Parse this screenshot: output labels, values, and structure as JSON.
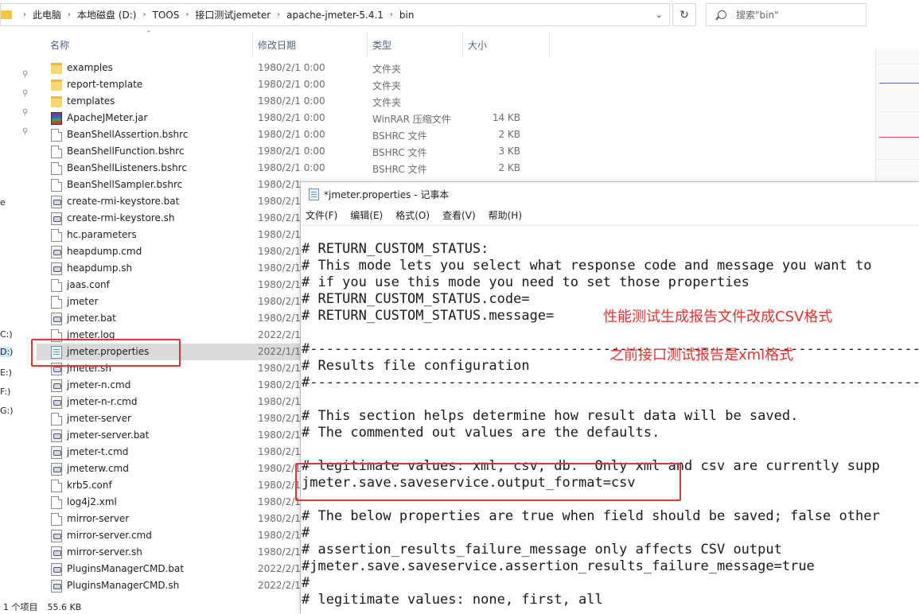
{
  "explorer": {
    "breadcrumb": [
      "此电脑",
      "本地磁盘 (D:)",
      "TOOS",
      "接口测试jemeter",
      "apache-jmeter-5.4.1",
      "bin"
    ],
    "search_placeholder": "搜索\"bin\"",
    "columns": {
      "name": "名称",
      "modified": "修改日期",
      "type": "类型",
      "size": "大小"
    },
    "drive_tags": [
      "C:)",
      "D:)",
      "E:)",
      "F:)",
      "G:)"
    ],
    "files": [
      {
        "name": "examples",
        "date": "1980/2/1 0:00",
        "type": "文件夹",
        "size": "",
        "icon": "folder"
      },
      {
        "name": "report-template",
        "date": "1980/2/1 0:00",
        "type": "文件夹",
        "size": "",
        "icon": "folder"
      },
      {
        "name": "templates",
        "date": "1980/2/1 0:00",
        "type": "文件夹",
        "size": "",
        "icon": "folder"
      },
      {
        "name": "ApacheJMeter.jar",
        "date": "1980/2/1 0:00",
        "type": "WinRAR 压缩文件",
        "size": "14 KB",
        "icon": "jar"
      },
      {
        "name": "BeanShellAssertion.bshrc",
        "date": "1980/2/1 0:00",
        "type": "BSHRC 文件",
        "size": "2 KB",
        "icon": "file"
      },
      {
        "name": "BeanShellFunction.bshrc",
        "date": "1980/2/1 0:00",
        "type": "BSHRC 文件",
        "size": "3 KB",
        "icon": "file"
      },
      {
        "name": "BeanShellListeners.bshrc",
        "date": "1980/2/1 0:00",
        "type": "BSHRC 文件",
        "size": "2 KB",
        "icon": "file"
      },
      {
        "name": "BeanShellSampler.bshrc",
        "date": "1980/2/1",
        "type": "",
        "size": "",
        "icon": "file"
      },
      {
        "name": "create-rmi-keystore.bat",
        "date": "1980/2/1",
        "type": "",
        "size": "",
        "icon": "gear"
      },
      {
        "name": "create-rmi-keystore.sh",
        "date": "1980/2/1",
        "type": "",
        "size": "",
        "icon": "gear"
      },
      {
        "name": "hc.parameters",
        "date": "1980/2/1",
        "type": "",
        "size": "",
        "icon": "file"
      },
      {
        "name": "heapdump.cmd",
        "date": "1980/2/1",
        "type": "",
        "size": "",
        "icon": "gear"
      },
      {
        "name": "heapdump.sh",
        "date": "1980/2/1",
        "type": "",
        "size": "",
        "icon": "gear"
      },
      {
        "name": "jaas.conf",
        "date": "1980/2/1",
        "type": "",
        "size": "",
        "icon": "file"
      },
      {
        "name": "jmeter",
        "date": "1980/2/1",
        "type": "",
        "size": "",
        "icon": "file"
      },
      {
        "name": "jmeter.bat",
        "date": "1980/2/1",
        "type": "",
        "size": "",
        "icon": "gear"
      },
      {
        "name": "jmeter.log",
        "date": "2022/2/1",
        "type": "",
        "size": "",
        "icon": "file"
      },
      {
        "name": "jmeter.properties",
        "date": "2022/1/1",
        "type": "",
        "size": "",
        "icon": "props"
      },
      {
        "name": "jmeter.sh",
        "date": "1980/2/1",
        "type": "",
        "size": "",
        "icon": "gear"
      },
      {
        "name": "jmeter-n.cmd",
        "date": "1980/2/1",
        "type": "",
        "size": "",
        "icon": "gear"
      },
      {
        "name": "jmeter-n-r.cmd",
        "date": "1980/2/1",
        "type": "",
        "size": "",
        "icon": "gear"
      },
      {
        "name": "jmeter-server",
        "date": "1980/2/1",
        "type": "",
        "size": "",
        "icon": "file"
      },
      {
        "name": "jmeter-server.bat",
        "date": "1980/2/1",
        "type": "",
        "size": "",
        "icon": "gear"
      },
      {
        "name": "jmeter-t.cmd",
        "date": "1980/2/1",
        "type": "",
        "size": "",
        "icon": "gear"
      },
      {
        "name": "jmeterw.cmd",
        "date": "1980/2/1",
        "type": "",
        "size": "",
        "icon": "gear"
      },
      {
        "name": "krb5.conf",
        "date": "1980/2/1",
        "type": "",
        "size": "",
        "icon": "file"
      },
      {
        "name": "log4j2.xml",
        "date": "1980/2/1",
        "type": "",
        "size": "",
        "icon": "file"
      },
      {
        "name": "mirror-server",
        "date": "1980/2/1",
        "type": "",
        "size": "",
        "icon": "file"
      },
      {
        "name": "mirror-server.cmd",
        "date": "1980/2/1",
        "type": "",
        "size": "",
        "icon": "gear"
      },
      {
        "name": "mirror-server.sh",
        "date": "1980/2/1",
        "type": "",
        "size": "",
        "icon": "gear"
      },
      {
        "name": "PluginsManagerCMD.bat",
        "date": "2022/2/1",
        "type": "",
        "size": "",
        "icon": "gear"
      },
      {
        "name": "PluginsManagerCMD.sh",
        "date": "2022/2/1",
        "type": "",
        "size": "",
        "icon": "gear"
      }
    ],
    "selected_file": "jmeter.properties",
    "status": {
      "selected": "1 个项目",
      "size": "55.6 KB"
    }
  },
  "notepad": {
    "title": "*jmeter.properties - 记事本",
    "menu": [
      "文件(F)",
      "编辑(E)",
      "格式(O)",
      "查看(V)",
      "帮助(H)"
    ],
    "lines": [
      "# RETURN_CUSTOM_STATUS:",
      "# This mode lets you select what response code and message you want to",
      "# if you use this mode you need to set those properties",
      "# RETURN_CUSTOM_STATUS.code=",
      "# RETURN_CUSTOM_STATUS.message=",
      "",
      "#---------------------------------------------------------------------------",
      "# Results file configuration",
      "#---------------------------------------------------------------------------",
      "",
      "# This section helps determine how result data will be saved.",
      "# The commented out values are the defaults.",
      "",
      "# legitimate values: xml, csv, db.  Only xml and csv are currently supp",
      "jmeter.save.saveservice.output_format=csv",
      "",
      "# The below properties are true when field should be saved; false other",
      "#",
      "# assertion_results_failure_message only affects CSV output",
      "#jmeter.save.saveservice.assertion_results_failure_message=true",
      "#",
      "# legitimate values: none, first, all"
    ]
  },
  "annotations": {
    "note1": "性能测试生成报告文件改成CSV格式",
    "note2": "之前接口测试报告是xml格式"
  },
  "colors": {
    "annotation": "#e8332e",
    "selected_row": "#d9d9d9",
    "header_text": "#4d6082"
  }
}
